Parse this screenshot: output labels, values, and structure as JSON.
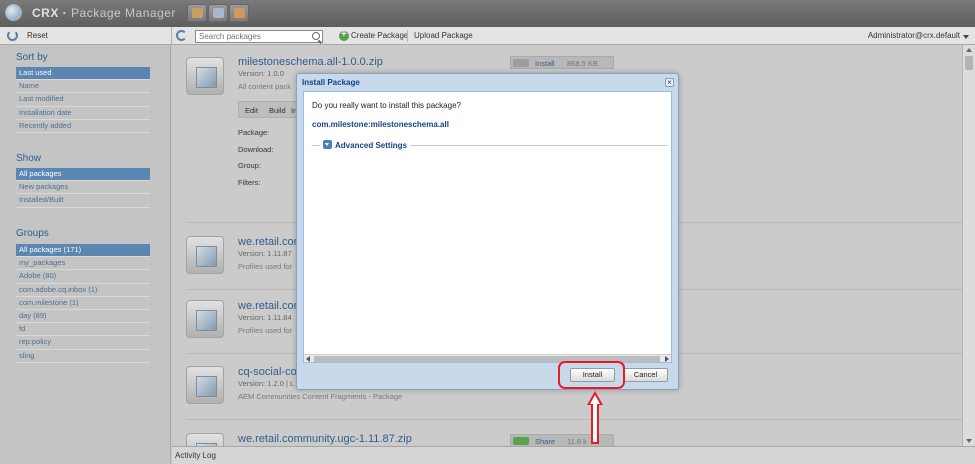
{
  "app": {
    "brand": "CRX",
    "title": "Package Manager"
  },
  "toolbar": {
    "reset_label": "Reset",
    "search_placeholder": "Search packages",
    "create_label": "Create Package",
    "upload_label": "Upload Package",
    "user_label": "Administrator@crx.default"
  },
  "sidebar": {
    "sort_heading": "Sort by",
    "sort_items": [
      "Last used",
      "Name",
      "Last modified",
      "Installation date",
      "Recently added"
    ],
    "show_heading": "Show",
    "show_items": [
      "All packages",
      "New packages",
      "Installed/Built"
    ],
    "groups_heading": "Groups",
    "group_items": [
      "All packages (171)",
      "my_packages",
      "Adobe (80)",
      "com.adobe.cq.inbox (1)",
      "com.milestone (1)",
      "day (89)",
      "fd",
      "rep:policy",
      "sling"
    ]
  },
  "packages": [
    {
      "name": "milestoneschema.all-1.0.0.zip",
      "version": "Version: 1.0.0",
      "description": "All content pack",
      "action_label": "Install",
      "action_size": "868.5 KB",
      "tabs": [
        "Edit",
        "Build",
        "In"
      ],
      "fields": [
        "Package:",
        "Download:",
        "Group:",
        "Filters:"
      ]
    },
    {
      "name": "we.retail.com",
      "version": "Version: 1.11.87",
      "description": "Profiles used for"
    },
    {
      "name": "we.retail.com",
      "version": "Version: 1.11.84",
      "description": "Profiles used for"
    },
    {
      "name": "cq-social-co",
      "version": "Version: 1.2.0 | L",
      "description": "AEM Communities Content Fragments - Package"
    },
    {
      "name": "we.retail.community.ugc-1.11.87.zip",
      "action_label": "Share",
      "action_size": "11.8 k"
    }
  ],
  "statusbar": {
    "label": "Activity Log"
  },
  "dialog": {
    "title": "Install Package",
    "question": "Do you really want to install this package?",
    "package_id": "com.milestone:milestoneschema.all",
    "advanced_label": "Advanced Settings",
    "install_label": "Install",
    "cancel_label": "Cancel"
  },
  "colors": {
    "accent": "#15428b",
    "highlight": "#e21f26",
    "selection": "#5b86b1"
  }
}
